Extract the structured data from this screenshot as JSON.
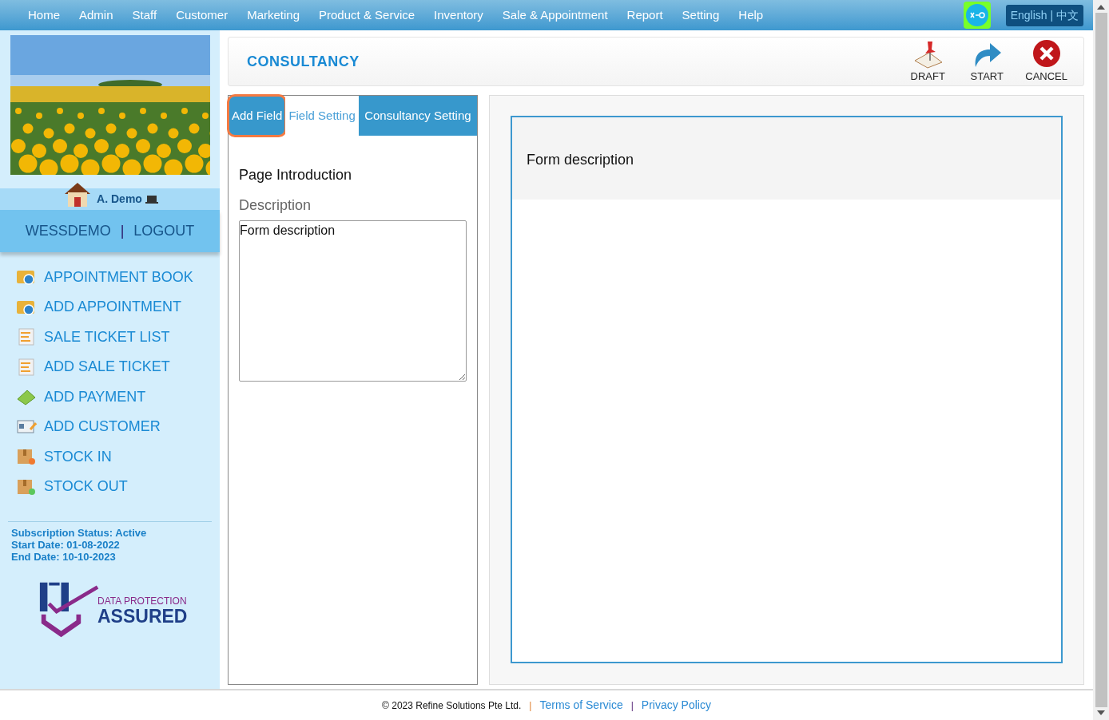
{
  "nav": {
    "items": [
      "Home",
      "Admin",
      "Staff",
      "Customer",
      "Marketing",
      "Product & Service",
      "Inventory",
      "Sale & Appointment",
      "Report",
      "Setting",
      "Help"
    ],
    "language": {
      "label": "English | 中文",
      "selected": true
    }
  },
  "sidebar": {
    "user": "A. Demo",
    "account": "WESSDEMO",
    "separator": "|",
    "logout": "LOGOUT",
    "menu": [
      {
        "label": "APPOINTMENT BOOK",
        "kind": "calendar"
      },
      {
        "label": "ADD APPOINTMENT",
        "kind": "calendar"
      },
      {
        "label": "SALE TICKET LIST",
        "kind": "ticket"
      },
      {
        "label": "ADD SALE TICKET",
        "kind": "ticket"
      },
      {
        "label": "ADD PAYMENT",
        "kind": "money"
      },
      {
        "label": "ADD CUSTOMER",
        "kind": "card"
      },
      {
        "label": "STOCK IN",
        "kind": "box-in"
      },
      {
        "label": "STOCK OUT",
        "kind": "box-out"
      }
    ],
    "subscription": [
      "Subscription Status: Active",
      "Start Date: 01-08-2022",
      "End Date: 10-10-2023"
    ],
    "badge": {
      "line1": "DATA PROTECTION",
      "line2": "ASSURED"
    }
  },
  "page": {
    "title": "CONSULTANCY",
    "actions": [
      {
        "label": "DRAFT",
        "kind": "draft"
      },
      {
        "label": "START",
        "kind": "start"
      },
      {
        "label": "CANCEL",
        "kind": "cancel"
      }
    ]
  },
  "tabs": [
    {
      "label": "Add Field",
      "selected": false,
      "highlighted": true
    },
    {
      "label": "Field Setting",
      "selected": true,
      "highlighted": false
    },
    {
      "label": "Consultancy Setting",
      "selected": false,
      "highlighted": false
    }
  ],
  "editor": {
    "section": "Page Introduction",
    "field_label": "Description",
    "value": "Form description"
  },
  "preview": {
    "description": "Form description"
  },
  "footer": {
    "copyright": "© 2023 Refine Solutions Pte Ltd.",
    "separators": [
      "|",
      "|"
    ],
    "links": [
      "Terms of Service",
      "Privacy Policy"
    ]
  }
}
